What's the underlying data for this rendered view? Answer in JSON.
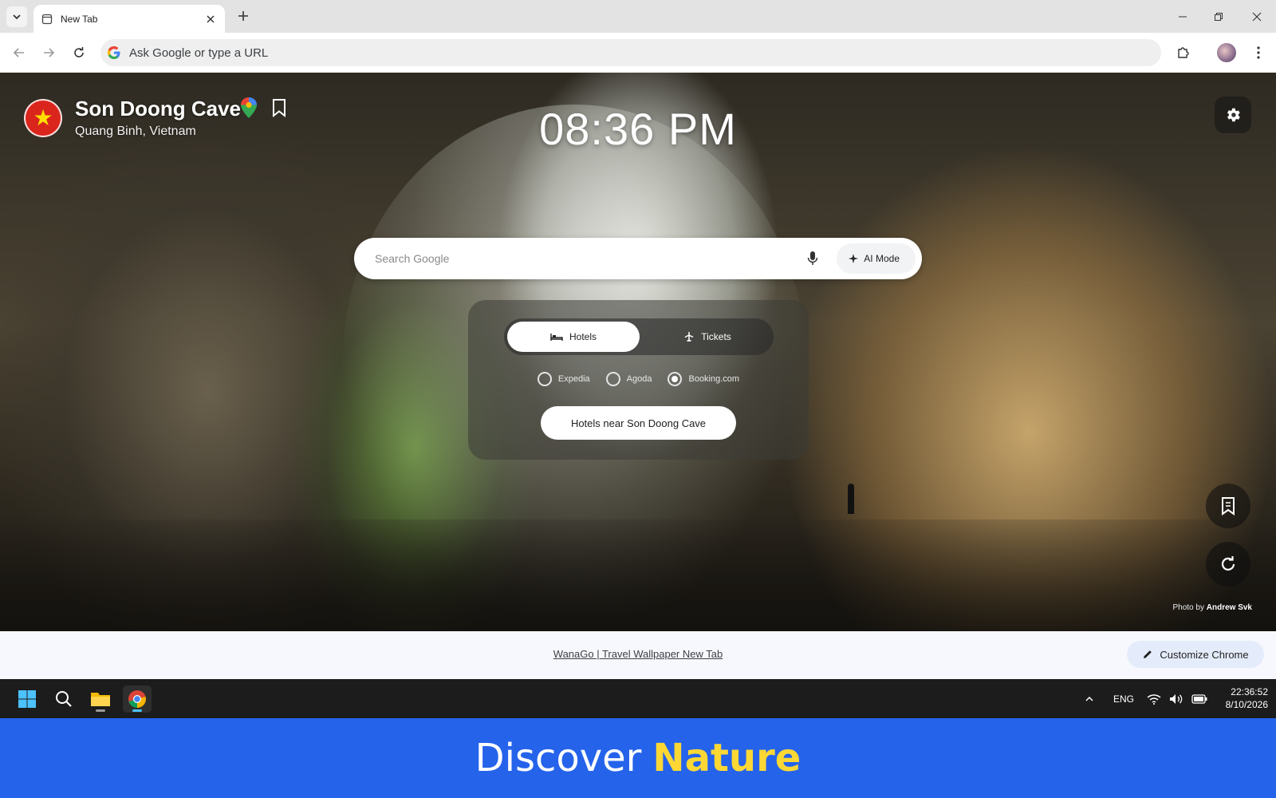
{
  "browser": {
    "tab_title": "New Tab",
    "omnibox_placeholder": "Ask Google or type a URL"
  },
  "location": {
    "title": "Son Doong Cave",
    "subtitle": "Quang Binh, Vietnam"
  },
  "clock": "08:36 PM",
  "search": {
    "placeholder": "Search Google",
    "ai_mode_label": "AI Mode"
  },
  "booking_panel": {
    "tabs": [
      {
        "label": "Hotels",
        "active": true
      },
      {
        "label": "Tickets",
        "active": false
      }
    ],
    "providers": [
      {
        "label": "Expedia",
        "selected": false
      },
      {
        "label": "Agoda",
        "selected": false
      },
      {
        "label": "Booking.com",
        "selected": true
      }
    ],
    "cta_label": "Hotels near Son Doong Cave"
  },
  "photo_credit": {
    "prefix": "Photo by",
    "author": "Andrew Svk"
  },
  "footer": {
    "link_text": "WanaGo | Travel Wallpaper New Tab",
    "customize_label": "Customize Chrome"
  },
  "taskbar": {
    "language": "ENG",
    "time": "22:36:52",
    "date": "8/10/2026"
  },
  "banner": {
    "text": "Discover",
    "accent": "Nature",
    "background_color": "#2563eb",
    "accent_color": "#fdd835"
  }
}
